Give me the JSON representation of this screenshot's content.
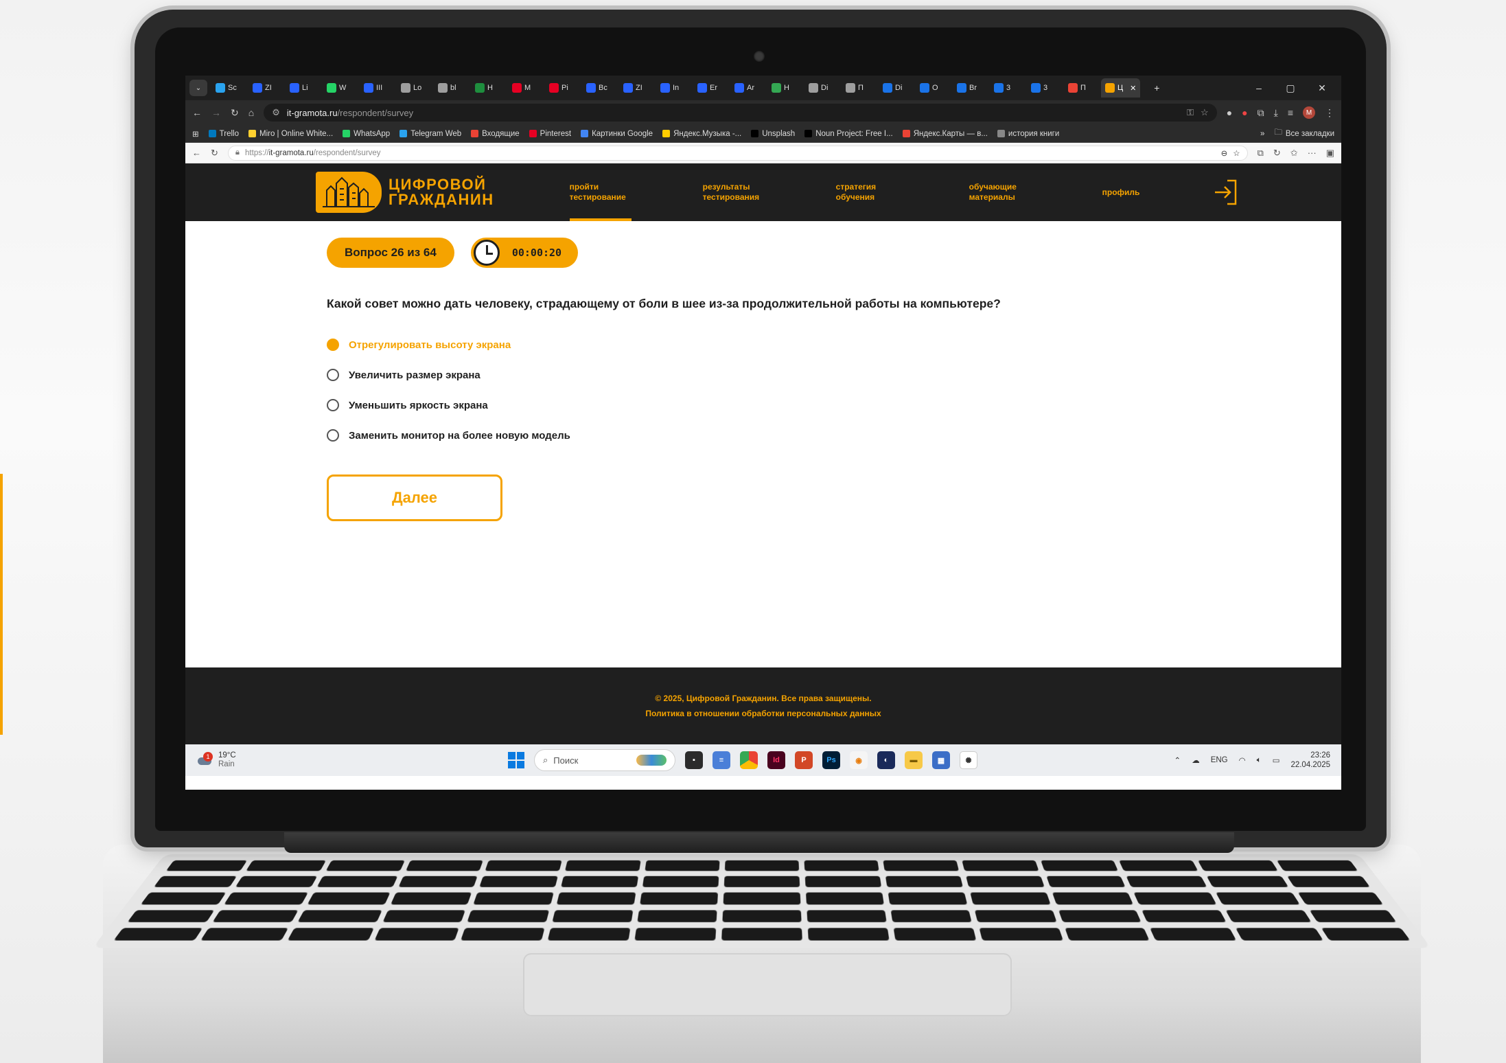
{
  "browser": {
    "tabs": [
      {
        "label": "Sc",
        "color": "#2aa3ef"
      },
      {
        "label": "ZI",
        "color": "#2962ff"
      },
      {
        "label": "Li",
        "color": "#2962ff"
      },
      {
        "label": "W",
        "color": "#25d366"
      },
      {
        "label": "III",
        "color": "#2962ff"
      },
      {
        "label": "Lo",
        "color": "#9e9e9e"
      },
      {
        "label": "bl",
        "color": "#9e9e9e"
      },
      {
        "label": "H",
        "color": "#1e8e3e"
      },
      {
        "label": "M",
        "color": "#e60023"
      },
      {
        "label": "Pi",
        "color": "#e60023"
      },
      {
        "label": "Bc",
        "color": "#2962ff"
      },
      {
        "label": "ZI",
        "color": "#2962ff"
      },
      {
        "label": "In",
        "color": "#2962ff"
      },
      {
        "label": "Er",
        "color": "#2962ff"
      },
      {
        "label": "Ar",
        "color": "#2962ff"
      },
      {
        "label": "H",
        "color": "#34a853"
      },
      {
        "label": "Di",
        "color": "#9e9e9e"
      },
      {
        "label": "П",
        "color": "#9e9e9e"
      },
      {
        "label": "Di",
        "color": "#1a73e8"
      },
      {
        "label": "O",
        "color": "#1a73e8"
      },
      {
        "label": "Br",
        "color": "#1a73e8"
      },
      {
        "label": "3",
        "color": "#1a73e8"
      },
      {
        "label": "3",
        "color": "#1a73e8"
      },
      {
        "label": "П",
        "color": "#ea4335"
      },
      {
        "label": "Ц",
        "color": "#f5a300",
        "active": true
      }
    ],
    "close_tab": "✕",
    "new_tab": "+",
    "window_controls": {
      "minimize": "–",
      "maximize": "▢",
      "close": "✕"
    },
    "address": {
      "host": "it-gramota.ru",
      "path": "/respondent/survey"
    },
    "bookmarks": [
      "Trello",
      "Miro | Online White...",
      "WhatsApp",
      "Telegram Web",
      "Входящие",
      "Pinterest",
      "Картинки Google",
      "Яндекс.Музыка -...",
      "Unsplash",
      "Noun Project: Free I...",
      "Яндекс.Карты — в...",
      "история книги"
    ],
    "bookmarks_more": "»",
    "all_bookmarks": "Все закладки",
    "inner_url": {
      "prefix": "https://",
      "host": "it-gramota.ru",
      "path": "/respondent/survey"
    },
    "avatar_letter": "M"
  },
  "site": {
    "logo_line1": "ЦИФРОВОЙ",
    "logo_line2": "ГРАЖДАНИН",
    "nav": [
      {
        "line1": "пройти",
        "line2": "тестирование",
        "active": true
      },
      {
        "line1": "результаты",
        "line2": "тестирования"
      },
      {
        "line1": "стратегия",
        "line2": "обучения"
      },
      {
        "line1": "обучающие",
        "line2": "материалы"
      },
      {
        "line1": "профиль",
        "line2": ""
      }
    ],
    "accent": "#f5a300",
    "dark": "#1f1f1f"
  },
  "survey": {
    "progress": "Вопрос 26 из 64",
    "timer": "00:00:20",
    "question": "Какой совет можно дать человеку, страдающему от боли в шее из-за продолжительной работы на компьютере?",
    "options": [
      {
        "label": "Отрегулировать высоту экрана",
        "selected": true
      },
      {
        "label": "Увеличить размер экрана",
        "selected": false
      },
      {
        "label": "Уменьшить яркость экрана",
        "selected": false
      },
      {
        "label": "Заменить монитор на более новую модель",
        "selected": false
      }
    ],
    "next_label": "Далее"
  },
  "footer": {
    "copyright": "© 2025, Цифровой Гражданин. Все права защищены.",
    "privacy": "Политика в отношении обработки персональных данных"
  },
  "taskbar": {
    "weather_temp": "19°C",
    "weather_desc": "Rain",
    "weather_badge": "1",
    "search_placeholder": "Поиск",
    "lang": "ENG",
    "time": "23:26",
    "date": "22.04.2025"
  }
}
